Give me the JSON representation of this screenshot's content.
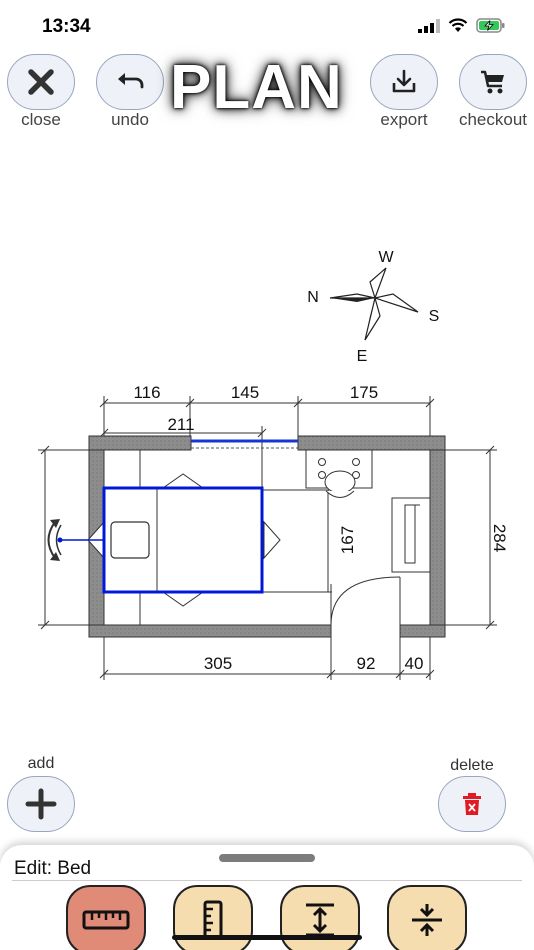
{
  "status": {
    "time": "13:34"
  },
  "header": {
    "title": "PLAN",
    "buttons": [
      {
        "id": "close",
        "label": "close",
        "icon": "close-icon"
      },
      {
        "id": "undo",
        "label": "undo",
        "icon": "undo-icon"
      },
      {
        "id": "export",
        "label": "export",
        "icon": "download-icon"
      },
      {
        "id": "checkout",
        "label": "checkout",
        "icon": "cart-icon"
      }
    ]
  },
  "compass": {
    "north": "N",
    "south": "S",
    "east": "E",
    "west": "W"
  },
  "plan": {
    "dimensions": {
      "top_segments": [
        "116",
        "145",
        "175"
      ],
      "window_offset": "211",
      "right_height": "284",
      "inner_height": "167",
      "bottom_segments": [
        "305",
        "92",
        "40"
      ]
    },
    "selection_color": "#0019d6"
  },
  "actions": {
    "add_label": "add",
    "delete_label": "delete"
  },
  "edit_sheet": {
    "label": "Edit: Bed",
    "tools": [
      {
        "icon": "ruler-icon",
        "active": true
      },
      {
        "icon": "ruler-vertical-icon",
        "active": false
      },
      {
        "icon": "expand-vertical-icon",
        "active": false
      },
      {
        "icon": "compress-vertical-icon",
        "active": false
      }
    ]
  }
}
